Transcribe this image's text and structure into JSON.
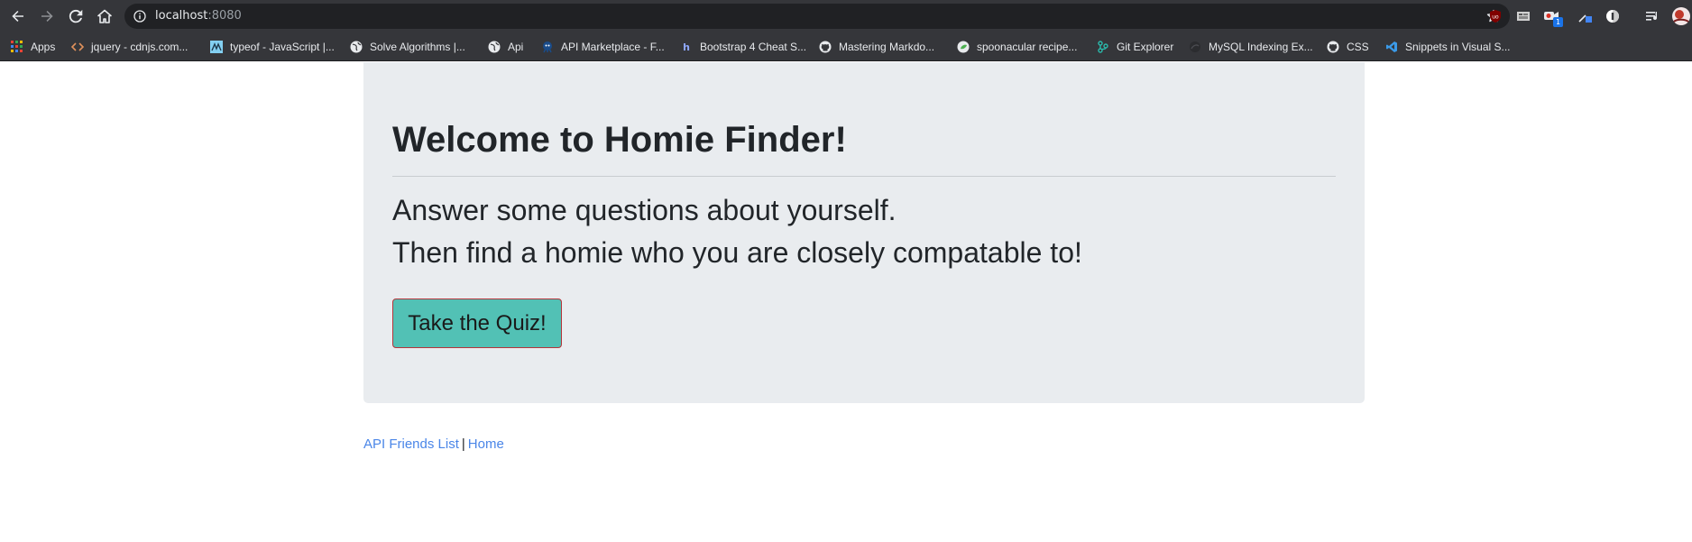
{
  "browser": {
    "url_host": "localhost",
    "url_port": ":8080",
    "extensions": [
      "ublock-icon",
      "screenshot-icon",
      "extension-badge-icon",
      "color-picker-icon",
      "circle-extension-icon",
      "media-icon",
      "profile-avatar-icon"
    ],
    "extension_badge": "1"
  },
  "bookmarks": [
    {
      "label": "Apps",
      "icon": "apps-grid-icon"
    },
    {
      "label": "jquery - cdnjs.com...",
      "icon": "code-icon"
    },
    {
      "label": "typeof - JavaScript |...",
      "icon": "mdn-icon"
    },
    {
      "label": "Solve Algorithms |...",
      "icon": "globe-icon"
    },
    {
      "label": "Api",
      "icon": "globe-icon"
    },
    {
      "label": "API Marketplace - F...",
      "icon": "rapidapi-icon"
    },
    {
      "label": "Bootstrap 4 Cheat S...",
      "icon": "hostinger-icon"
    },
    {
      "label": "Mastering Markdo...",
      "icon": "github-icon"
    },
    {
      "label": "spoonacular recipe...",
      "icon": "spoonacular-icon"
    },
    {
      "label": "Git Explorer",
      "icon": "git-explorer-icon"
    },
    {
      "label": "MySQL Indexing Ex...",
      "icon": "mysql-icon"
    },
    {
      "label": "CSS",
      "icon": "github-icon"
    },
    {
      "label": "Snippets in Visual S...",
      "icon": "vscode-icon"
    }
  ],
  "jumbotron": {
    "title": "Welcome to Homie Finder!",
    "lead_line1": "Answer some questions about yourself.",
    "lead_line2": "Then find a homie who you are closely compatable to!",
    "button_label": "Take the Quiz!"
  },
  "footer": {
    "link1": "API Friends List",
    "separator": "|",
    "link2": "Home"
  },
  "colors": {
    "toolbar_bg": "#35363a",
    "jumbotron_bg": "#e9ecef",
    "button_bg": "#52c1b5",
    "button_border": "#b5343a",
    "link": "#4a86e8"
  }
}
